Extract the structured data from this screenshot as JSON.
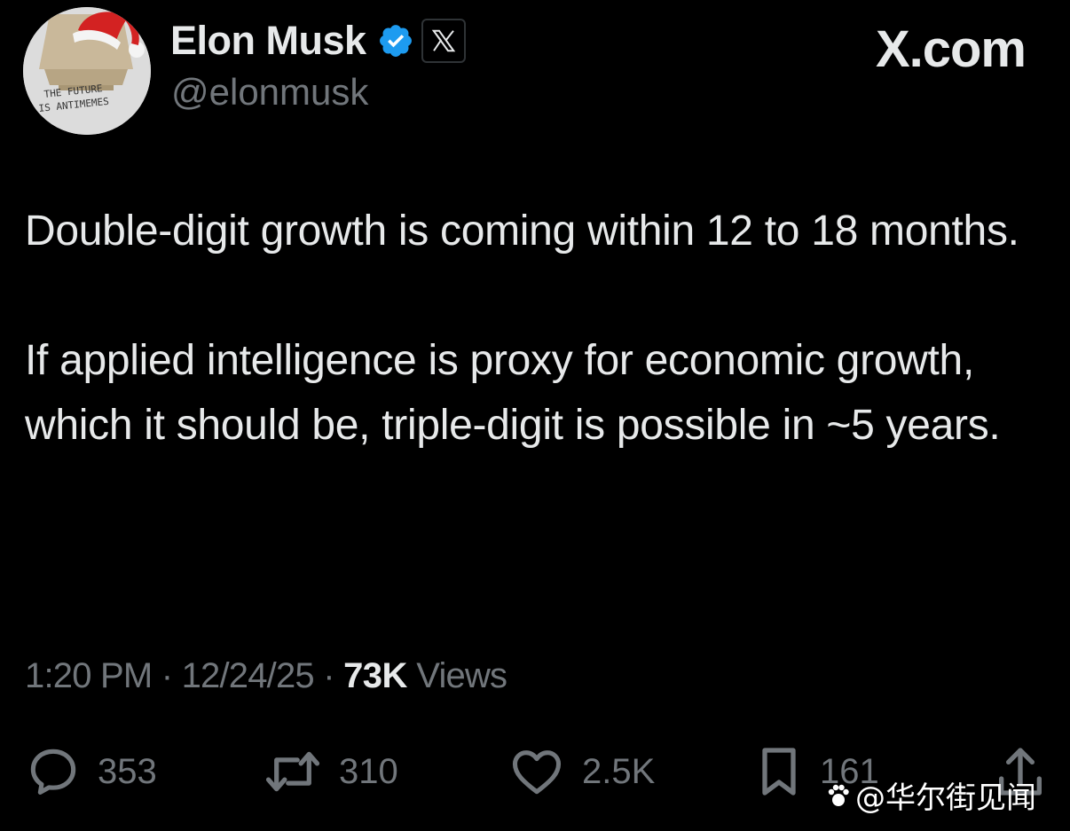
{
  "author": {
    "display_name": "Elon Musk",
    "handle": "@elonmusk",
    "avatar_text": [
      "THE FUTURE",
      "IS ANTIMEMES"
    ]
  },
  "brand": "X.com",
  "tweet": {
    "paragraphs": [
      "Double-digit growth is coming within 12 to 18 months.",
      "If applied intelligence is proxy for economic growth, which it should be, triple-digit is possible in ~5 years."
    ]
  },
  "meta": {
    "time": "1:20 PM",
    "sep1": "·",
    "date": "12/24/25",
    "sep2": "·",
    "views_count": "73K",
    "views_label": "Views"
  },
  "actions": {
    "replies": "353",
    "reposts": "310",
    "likes": "2.5K",
    "bookmarks": "161"
  },
  "watermark": "@华尔街见闻",
  "colors": {
    "background": "#000000",
    "text": "#e7e9ea",
    "secondary": "#71767b",
    "verified": "#1d9bf0"
  },
  "icons": [
    "verified-badge-icon",
    "x-logo-icon",
    "reply-icon",
    "repost-icon",
    "like-icon",
    "bookmark-icon",
    "share-icon"
  ]
}
